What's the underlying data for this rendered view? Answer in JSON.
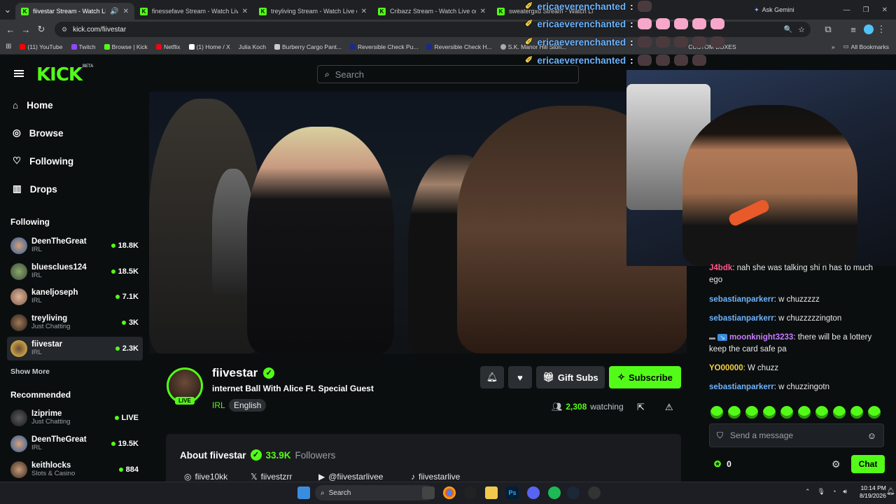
{
  "browser": {
    "tabs": [
      {
        "title": "fiivestar Stream - Watch Li",
        "active": true
      },
      {
        "title": "finessefave Stream - Watch Live",
        "active": false
      },
      {
        "title": "treyliving Stream - Watch Live o",
        "active": false
      },
      {
        "title": "Cribazz Stream - Watch Live on",
        "active": false
      },
      {
        "title": "sweatergxd Stream - Watch Li",
        "active": false
      }
    ],
    "ask_gemini": "Ask Gemini",
    "url": "kick.com/fiivestar",
    "bookmarks": [
      {
        "label": "(11) YouTube",
        "color": "#ff0000"
      },
      {
        "label": "Twitch",
        "color": "#9146ff"
      },
      {
        "label": "Browse | Kick",
        "color": "#53fc18"
      },
      {
        "label": "Netflix",
        "color": "#e50914"
      },
      {
        "label": "(1) Home / X",
        "color": "#ffffff"
      },
      {
        "label": "Julia Koch",
        "color": "#888888"
      },
      {
        "label": "Burberry Cargo Pant...",
        "color": "#cccccc"
      },
      {
        "label": "Reversible Check Pu...",
        "color": "#1a2a8a"
      },
      {
        "label": "Reversible Check H...",
        "color": "#1a2a8a"
      },
      {
        "label": "S.K. Manor Hill Stori...",
        "color": "#aaaaaa"
      },
      {
        "label": "CUSTOM BOXES",
        "color": "#666666"
      }
    ],
    "all_bookmarks": "All Bookmarks"
  },
  "overlay_chat": [
    {
      "user": "ericaeverenchanted",
      "emotes": [
        "dk"
      ]
    },
    {
      "user": "ericaeverenchanted",
      "emotes": [
        "pk",
        "pk",
        "pk",
        "pk",
        "pk"
      ]
    },
    {
      "user": "ericaeverenchanted",
      "emotes": [
        "dk",
        "dk",
        "dk",
        "dk",
        "dk"
      ]
    },
    {
      "user": "ericaeverenchanted",
      "emotes": [
        "dk",
        "dk",
        "dk",
        "dk"
      ]
    }
  ],
  "kick": {
    "logo": "KICK",
    "beta": "BETA",
    "search_placeholder": "Search",
    "nav": [
      "Home",
      "Browse",
      "Following",
      "Drops"
    ],
    "following_heading": "Following",
    "following": [
      {
        "name": "DeenTheGreat",
        "category": "IRL",
        "viewers": "18.8K"
      },
      {
        "name": "bluesclues124",
        "category": "IRL",
        "viewers": "18.5K"
      },
      {
        "name": "kaneljoseph",
        "category": "IRL",
        "viewers": "7.1K"
      },
      {
        "name": "treyliving",
        "category": "Just Chatting",
        "viewers": "3K"
      },
      {
        "name": "fiivestar",
        "category": "IRL",
        "viewers": "2.3K"
      }
    ],
    "show_more": "Show More",
    "recommended_heading": "Recommended",
    "recommended": [
      {
        "name": "Iziprime",
        "category": "Just Chatting",
        "viewers": "LIVE"
      },
      {
        "name": "DeenTheGreat",
        "category": "IRL",
        "viewers": "19.5K"
      },
      {
        "name": "keithlocks",
        "category": "Slots & Casino",
        "viewers": "884"
      }
    ]
  },
  "channel": {
    "name": "fiivestar",
    "live_badge": "LIVE",
    "title": "internet Ball With Alice Ft. Special Guest",
    "category": "IRL",
    "language": "English",
    "gift_subs": "Gift Subs",
    "subscribe": "Subscribe",
    "viewers": "2,308",
    "watching_label": "watching",
    "about_title": "About fiivestar",
    "followers_count": "33.9K",
    "followers_label": "Followers",
    "socials": [
      {
        "icon": "instagram-icon",
        "handle": "fiive10kk"
      },
      {
        "icon": "x-icon",
        "handle": "fiivestzrr"
      },
      {
        "icon": "youtube-icon",
        "handle": "@fiivestarlivee"
      },
      {
        "icon": "tiktok-icon",
        "handle": "fiivestarlive"
      }
    ]
  },
  "chat": {
    "messages": [
      {
        "user": "J4bdk",
        "color": "#ff5a8a",
        "text": "nah she was talking shi n has to much ego"
      },
      {
        "user": "sebastianparkerr",
        "color": "#6cb4ff",
        "text": "w chuzzzzz"
      },
      {
        "user": "sebastianparkerr",
        "color": "#6cb4ff",
        "text": "w chuzzzzzington"
      },
      {
        "user": "moonknight3233",
        "color": "#c77dff",
        "text": "there will be a lottery keep the card safe pa"
      },
      {
        "user": "YO00000",
        "color": "#f5d142",
        "text": "W chuzz"
      },
      {
        "user": "sebastianparkerr",
        "color": "#6cb4ff",
        "text": "w chuzzingotn"
      }
    ],
    "placeholder": "Send a message",
    "points": "0",
    "chat_button": "Chat"
  },
  "taskbar": {
    "search": "Search",
    "time": "10:14 PM",
    "date": "8/19/2026"
  }
}
